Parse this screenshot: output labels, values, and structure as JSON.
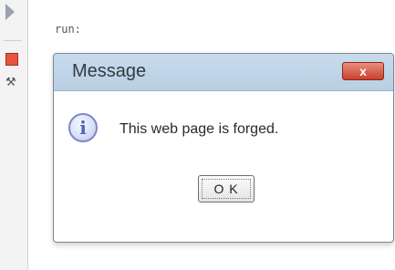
{
  "ide": {
    "output_text": "run:",
    "gutter_icons": [
      "play-icon",
      "stop-icon",
      "tool-icon"
    ]
  },
  "dialog": {
    "title": "Message",
    "close_label": "x",
    "icon": "info-icon",
    "icon_glyph": "i",
    "message": "This web page is forged.",
    "ok_label": "O K"
  },
  "colors": {
    "titlebar": "#b9cfe3",
    "close_button": "#c9402c",
    "info_icon": "#7d88c4"
  }
}
